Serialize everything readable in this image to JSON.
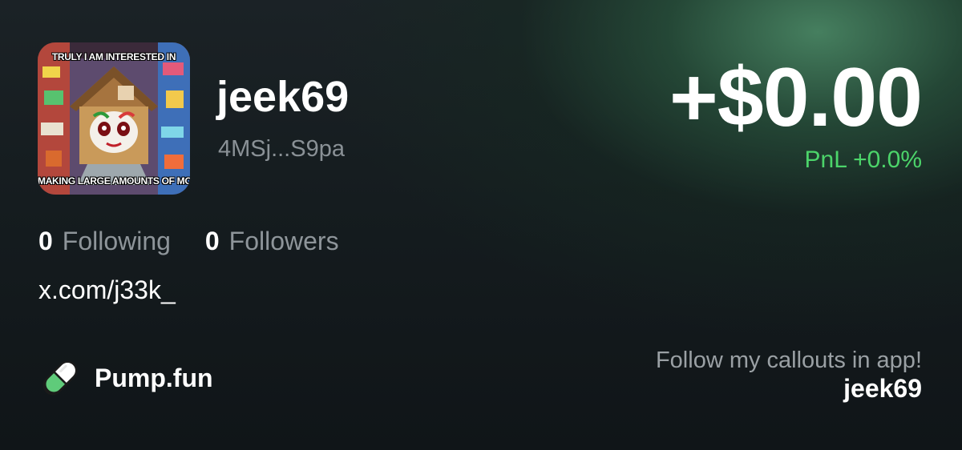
{
  "profile": {
    "avatar_icon": "meme-avatar-image",
    "avatar_caption_top": "TRULY I AM INTERESTED IN",
    "avatar_caption_bottom": "MAKING LARGE AMOUNTS OF MONEY",
    "username": "jeek69",
    "wallet": "4MSj...S9pa"
  },
  "stats": {
    "following_count": "0",
    "following_label": "Following",
    "followers_count": "0",
    "followers_label": "Followers"
  },
  "social_link": "x.com/j33k_",
  "brand": {
    "icon": "pill-icon",
    "name": "Pump.fun"
  },
  "pnl": {
    "value": "+$0.00",
    "percent_text": "PnL +0.0%",
    "percent_color": "#4cd46a"
  },
  "cta": {
    "text": "Follow my callouts in app!",
    "username": "jeek69"
  }
}
